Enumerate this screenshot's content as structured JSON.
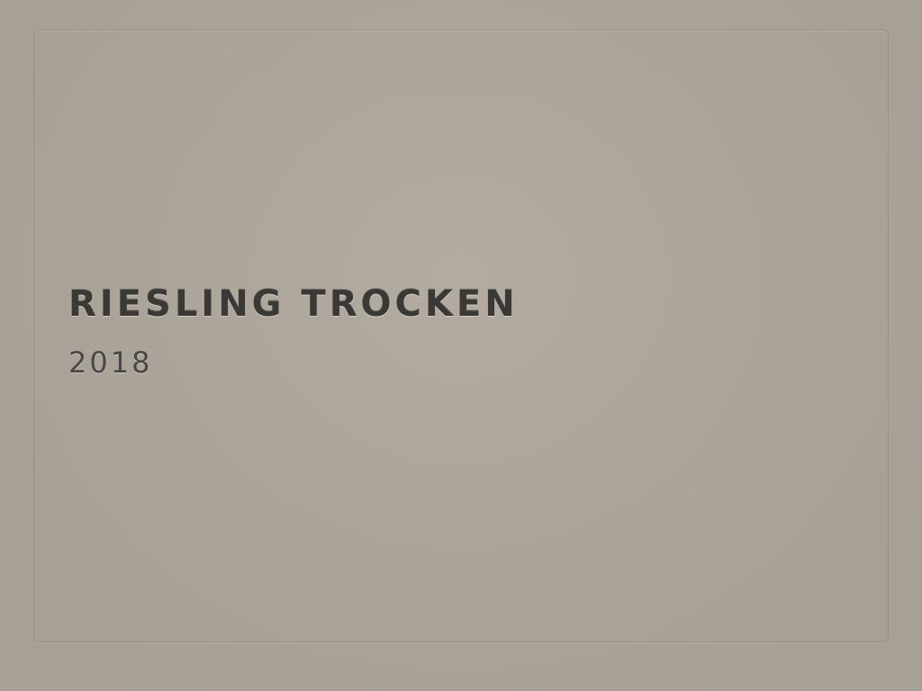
{
  "slide": {
    "title": "RIESLING TROCKEN",
    "subtitle": "2018"
  },
  "colors": {
    "background": "#aea69b",
    "title": "#3a3936",
    "subtitle": "#4a4845"
  }
}
